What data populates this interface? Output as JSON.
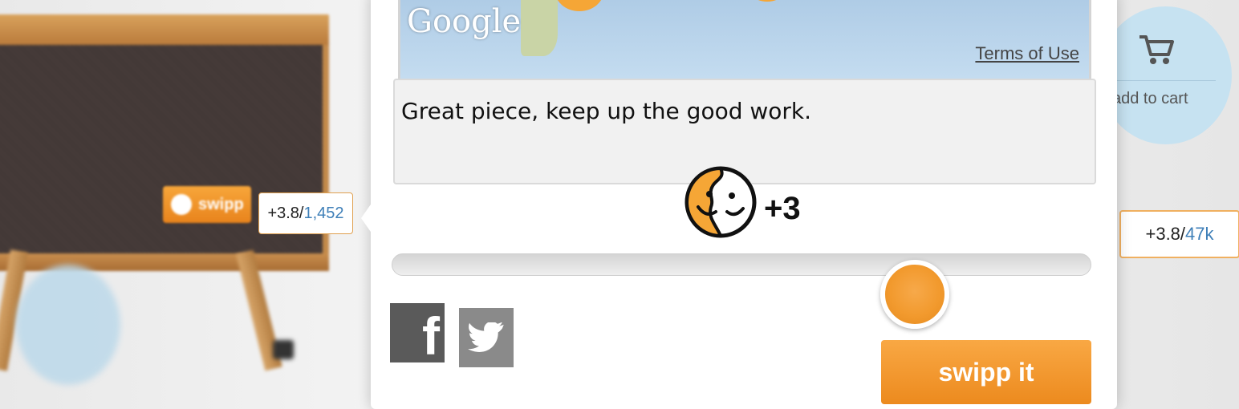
{
  "background": {
    "left_badge": {
      "brand": "swipp",
      "score": "+3.8/",
      "total": "1,452"
    },
    "right_cart": {
      "label": "add to cart",
      "icon": "cart-icon"
    },
    "right_score": {
      "score": "+3.8/",
      "total": "47k"
    }
  },
  "panel": {
    "map": {
      "provider": "Google",
      "terms_link": "Terms of Use"
    },
    "comment": {
      "value": "Great piece, keep up the good work."
    },
    "rating": {
      "icon": "swipp-face-icon",
      "label": "+3",
      "slider_level": 0.73
    },
    "share": {
      "facebook_icon": "facebook-icon",
      "twitter_icon": "twitter-icon"
    },
    "submit_label": "swipp it"
  },
  "colors": {
    "accent": "#f29a2e",
    "link_blue": "#3e7fb8"
  }
}
